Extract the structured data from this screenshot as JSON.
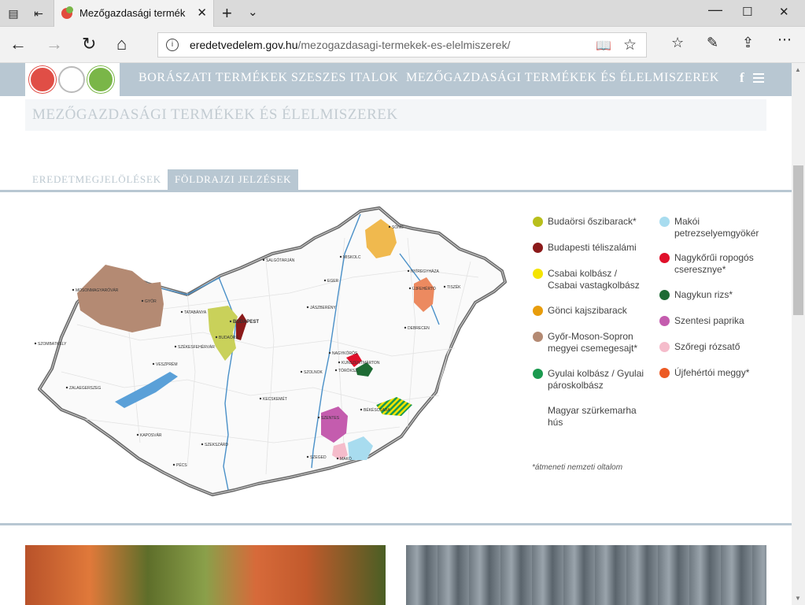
{
  "browser": {
    "tab_title": "Mezőgazdasági termék",
    "url_domain": "eredetvedelem.gov.hu",
    "url_path": "/mezogazdasagi-termekek-es-elelmiszerek/"
  },
  "site": {
    "menu": [
      "BORÁSZATI TERMÉKEK",
      "SZESZES ITALOK",
      "MEZŐGAZDASÁGI TERMÉKEK ÉS ÉLELMISZEREK"
    ],
    "facebook_label": "f",
    "page_title": "MEZŐGAZDASÁGI TERMÉKEK ÉS ÉLELMISZEREK",
    "subtabs": [
      "EREDETMEGJELÖLÉSEK",
      "FÖLDRAJZI JELZÉSEK"
    ]
  },
  "map": {
    "cities": [
      "SÓNG",
      "SALGÓTARJÁN",
      "MISKOLC",
      "NYÍREGYHÁZA",
      "MOSONMAGYARÓVÁR",
      "GYŐR",
      "EGER",
      "TATABÁNYA",
      "BUDAPEST",
      "JÁSZBERÉNY",
      "ÚJFEHÉRTÓ",
      "DEBRECEN",
      "TISZÉK",
      "SZOMBATHELY",
      "SZÉKESFEHÉRVÁR",
      "BUDAÖRS",
      "NAGYKŐRÖS",
      "KUNSZENTMÁRTON",
      "TÖRÖKSZ.",
      "VESZPRÉM",
      "SZOLNOK",
      "ZALAEGERSZEG",
      "KECSKEMÉT",
      "SZENTES",
      "BÉKÉSCSABA",
      "KAPOSVÁR",
      "SZEKSZÁRD",
      "SZEGED",
      "MAKÓ",
      "PÉCS"
    ]
  },
  "legend": {
    "left": [
      {
        "label": "Budaörsi őszibarack*",
        "color": "#b8bf1c"
      },
      {
        "label": "Budapesti téliszalámi",
        "color": "#8b1a1a"
      },
      {
        "label": "Csabai kolbász / Csabai vastagkolbász",
        "color": "#f4e400"
      },
      {
        "label": "Gönci kajszibarack",
        "color": "#e89d0c"
      },
      {
        "label": "Győr-Moson-Sopron megyei csemegesajt*",
        "color": "#b48a73"
      },
      {
        "label": "Gyulai kolbász / Gyulai pároskolbász",
        "color": "#1b9a4f"
      },
      {
        "label": "Magyar szürkemarha hús",
        "color": ""
      }
    ],
    "right": [
      {
        "label": "Makói petrezselyemgyökér",
        "color": "#a8dcef"
      },
      {
        "label": "Nagykőrűi ropogós cseresznye*",
        "color": "#e0102a"
      },
      {
        "label": "Nagykun rizs*",
        "color": "#1e6b34"
      },
      {
        "label": "Szentesi paprika",
        "color": "#c45cae"
      },
      {
        "label": "Szőregi rózsatő",
        "color": "#f5bccb"
      },
      {
        "label": "Újfehértói meggy*",
        "color": "#ec5a24"
      }
    ],
    "footnote": "*átmeneti nemzeti oltalom"
  }
}
